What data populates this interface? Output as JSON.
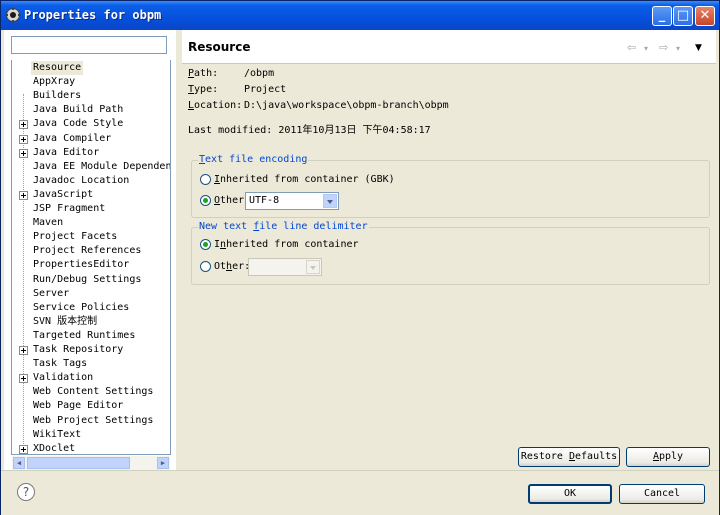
{
  "window": {
    "title": "Properties for obpm"
  },
  "filter": {
    "value": "",
    "placeholder": ""
  },
  "tree": {
    "items": [
      {
        "label": "Resource",
        "expandable": false,
        "selected": true
      },
      {
        "label": "AppXray",
        "expandable": false
      },
      {
        "label": "Builders",
        "expandable": false
      },
      {
        "label": "Java Build Path",
        "expandable": false
      },
      {
        "label": "Java Code Style",
        "expandable": true
      },
      {
        "label": "Java Compiler",
        "expandable": true
      },
      {
        "label": "Java Editor",
        "expandable": true
      },
      {
        "label": "Java EE Module Dependenc",
        "expandable": false
      },
      {
        "label": "Javadoc Location",
        "expandable": false
      },
      {
        "label": "JavaScript",
        "expandable": true
      },
      {
        "label": "JSP Fragment",
        "expandable": false
      },
      {
        "label": "Maven",
        "expandable": false
      },
      {
        "label": "Project Facets",
        "expandable": false
      },
      {
        "label": "Project References",
        "expandable": false
      },
      {
        "label": "PropertiesEditor",
        "expandable": false
      },
      {
        "label": "Run/Debug Settings",
        "expandable": false
      },
      {
        "label": "Server",
        "expandable": false
      },
      {
        "label": "Service Policies",
        "expandable": false
      },
      {
        "label": "SVN 版本控制",
        "expandable": false
      },
      {
        "label": "Targeted Runtimes",
        "expandable": false
      },
      {
        "label": "Task Repository",
        "expandable": true
      },
      {
        "label": "Task Tags",
        "expandable": false
      },
      {
        "label": "Validation",
        "expandable": true
      },
      {
        "label": "Web Content Settings",
        "expandable": false
      },
      {
        "label": "Web Page Editor",
        "expandable": false
      },
      {
        "label": "Web Project Settings",
        "expandable": false
      },
      {
        "label": "WikiText",
        "expandable": false
      },
      {
        "label": "XDoclet",
        "expandable": true
      }
    ]
  },
  "page": {
    "title": "Resource",
    "path_label": "Path:",
    "path_value": "/obpm",
    "type_label": "Type:",
    "type_value": "Project",
    "location_label": "Location:",
    "location_value": "D:\\java\\workspace\\obpm-branch\\obpm",
    "last_modified_label": "Last modified:",
    "last_modified_value": "2011年10月13日 下午04:58:17"
  },
  "encoding_group": {
    "title": "Text file encoding",
    "inherited_label": "Inherited from container (GBK)",
    "other_label": "Other:",
    "other_value": "UTF-8",
    "selected": "other"
  },
  "delimiter_group": {
    "title": "New text file line delimiter",
    "inherited_label": "Inherited from container",
    "other_label": "Other:",
    "other_value": "",
    "selected": "inherited"
  },
  "buttons": {
    "restore_defaults": "Restore Defaults",
    "apply": "Apply",
    "ok": "OK",
    "cancel": "Cancel",
    "help": "?"
  },
  "title_buttons": {
    "minimize": "_",
    "maximize": "□",
    "close": "✕"
  },
  "colors": {
    "titlebar": "#0550dc",
    "group_title": "#0046d5",
    "dialog_bg": "#ece9d8"
  }
}
